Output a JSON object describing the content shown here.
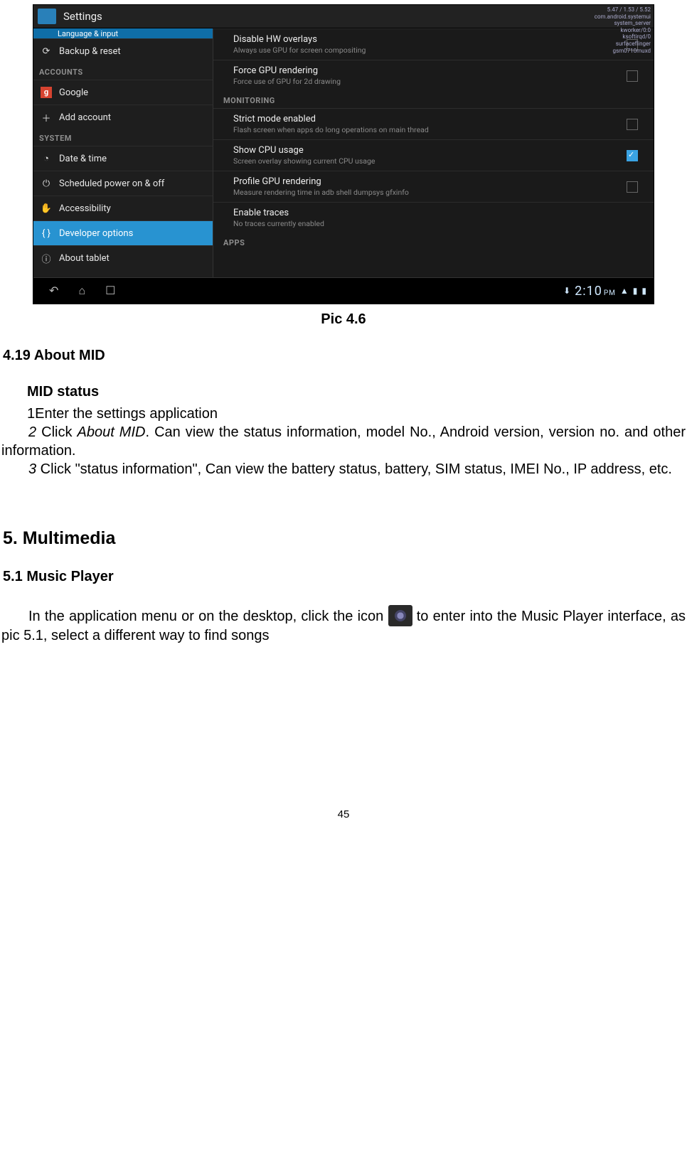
{
  "screenshot": {
    "title": "Settings",
    "overlay_lines": "5.47 / 1.53 / 5.52\ncom.android.systemui\nsystem_server\nkworker/0:0\nksoftirqd/0\nsurfaceflinger\ngsm0710muxd",
    "sidebar": {
      "cut_item": "Language & input",
      "backup": "Backup & reset",
      "accounts_header": "ACCOUNTS",
      "google": "Google",
      "add_account": "Add account",
      "system_header": "SYSTEM",
      "datetime": "Date & time",
      "scheduled": "Scheduled power on & off",
      "accessibility": "Accessibility",
      "developer": "Developer options",
      "about": "About tablet"
    },
    "main": {
      "disable_hw": {
        "title": "Disable HW overlays",
        "sub": "Always use GPU for screen compositing"
      },
      "force_gpu": {
        "title": "Force GPU rendering",
        "sub": "Force use of GPU for 2d drawing"
      },
      "monitoring_header": "MONITORING",
      "strict": {
        "title": "Strict mode enabled",
        "sub": "Flash screen when apps do long operations on main thread"
      },
      "cpu": {
        "title": "Show CPU usage",
        "sub": "Screen overlay showing current CPU usage"
      },
      "profile": {
        "title": "Profile GPU rendering",
        "sub": "Measure rendering time in adb shell dumpsys gfxinfo"
      },
      "traces": {
        "title": "Enable traces",
        "sub": "No traces currently enabled"
      },
      "apps_header": "APPS"
    },
    "navbar": {
      "clock": "2:10",
      "ampm": "PM"
    }
  },
  "caption": "Pic 4.6",
  "h_about": "4.19 About MID",
  "h_midstatus": "MID status",
  "step1": "1Enter the settings application",
  "step2_lead": "2",
  "step2_ital": " Click ",
  "step2_ital2": "About MID",
  "step2_rest": ". Can view the status information, model No., Android version, version no. and other information.",
  "step3_lead": "3",
  "step3_rest": " Click \"status information\", Can view the battery status, battery, SIM status, IMEI No., IP address, etc.",
  "h_multimedia": "5. Multimedia",
  "h_music": "5.1 Music Player",
  "music_p1": "In the application menu or on the desktop, click the icon ",
  "music_p2": " to enter into the Music Player interface, as pic 5.1, select a different way to find songs",
  "pagenum": "45"
}
